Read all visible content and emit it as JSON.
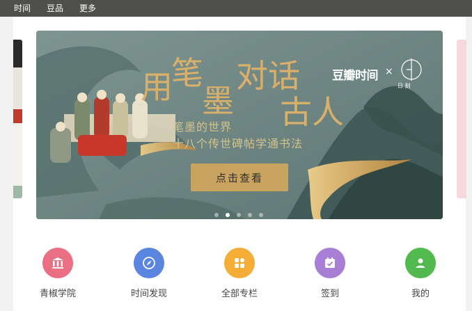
{
  "topnav": {
    "items": [
      {
        "label": "时间"
      },
      {
        "label": "豆品"
      },
      {
        "label": "更多"
      }
    ]
  },
  "banner": {
    "headline": [
      "用",
      "笔",
      "墨",
      "对话",
      "古人"
    ],
    "subtitle_line1": "笔墨的世界",
    "subtitle_line2": "十八个传世碑帖学通书法",
    "brand_name": "豆瓣时间",
    "brand_times": "×",
    "partner_small": "日 刻",
    "cta_label": "点击查看",
    "slide_count": 5,
    "active_slide": 2,
    "colors": {
      "gold": "#d9b06a",
      "cta_gold": "#c9a461",
      "bg": "#6f8784"
    }
  },
  "shortcuts": [
    {
      "label": "青椒学院",
      "icon": "bank-icon",
      "color": "#ea6f82"
    },
    {
      "label": "时间发现",
      "icon": "compass-icon",
      "color": "#5b86e0"
    },
    {
      "label": "全部专栏",
      "icon": "grid-icon",
      "color": "#f4ad37"
    },
    {
      "label": "签到",
      "icon": "calendar-check-icon",
      "color": "#a97ed5"
    },
    {
      "label": "我的",
      "icon": "user-icon",
      "color": "#52b94e"
    }
  ]
}
